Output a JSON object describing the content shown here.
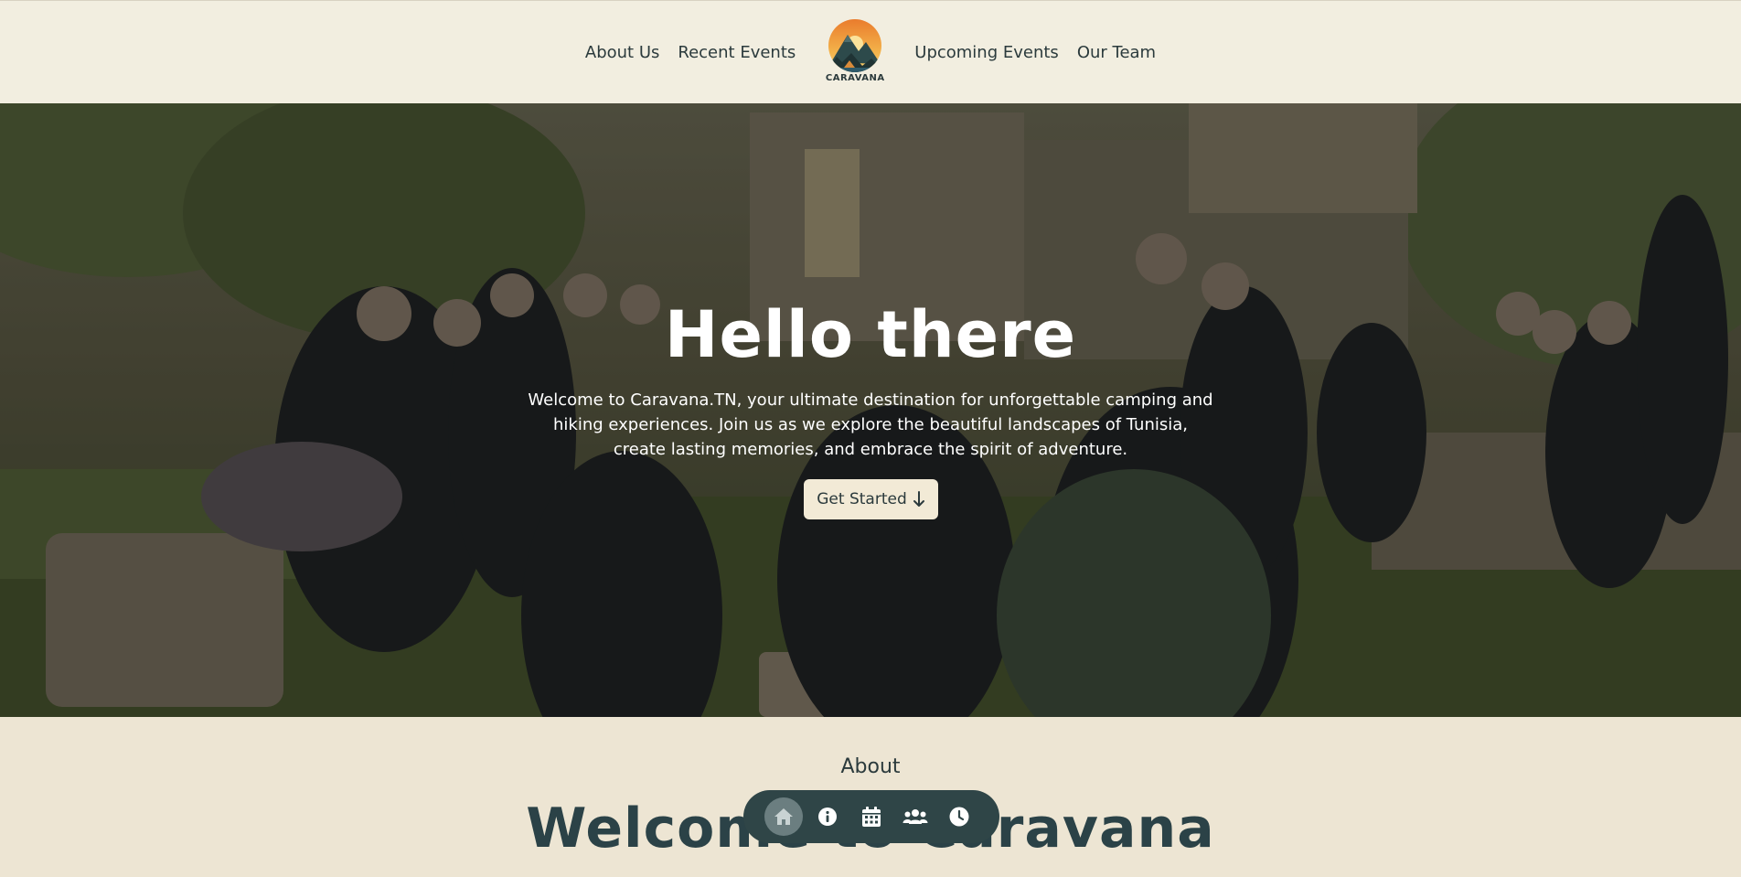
{
  "nav": {
    "left": [
      "About Us",
      "Recent Events"
    ],
    "right": [
      "Upcoming Events",
      "Our Team"
    ],
    "logo_text": "CARAVANA"
  },
  "hero": {
    "title": "Hello there",
    "subtitle": "Welcome to Caravana.TN, your ultimate destination for unforgettable camping and hiking experiences. Join us as we explore the beautiful landscapes of Tunisia, create lasting memories, and embrace the spirit of adventure.",
    "cta_label": "Get Started",
    "cta_icon": "arrow-down-icon"
  },
  "about": {
    "label": "About",
    "title": "Welcome to Caravana"
  },
  "dock": {
    "items": [
      {
        "icon": "home-icon",
        "active": true
      },
      {
        "icon": "info-icon",
        "active": false
      },
      {
        "icon": "calendar-icon",
        "active": false
      },
      {
        "icon": "users-icon",
        "active": false
      },
      {
        "icon": "clock-icon",
        "active": false
      }
    ]
  },
  "colors": {
    "header_bg": "#f2eee0",
    "page_bg": "#ede5d3",
    "text_dark": "#2b3a3c",
    "dock_bg": "#2f4547",
    "cta_bg": "#f2ead6"
  }
}
